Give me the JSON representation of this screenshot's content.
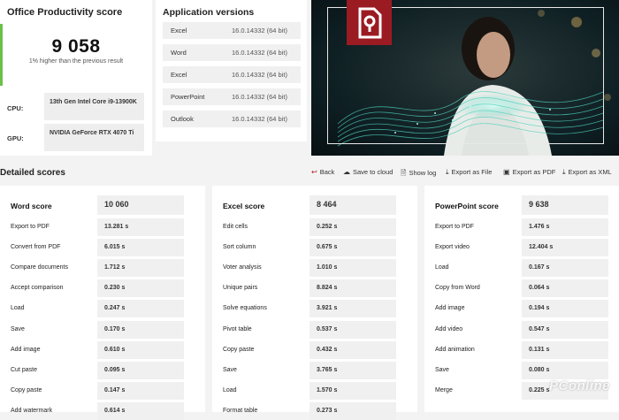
{
  "summary": {
    "title": "Office Productivity score",
    "score": "9 058",
    "comparison": "1% higher than the previous result",
    "cpu_label": "CPU:",
    "cpu_value": "13th Gen Intel Core i9-13900K",
    "gpu_label": "GPU:",
    "gpu_value": "NVIDIA GeForce RTX 4070 Ti",
    "accent_color": "#6cc04a"
  },
  "apps": {
    "title": "Application versions",
    "rows": [
      {
        "name": "Excel",
        "version": "16.0.14332 (64 bit)"
      },
      {
        "name": "Word",
        "version": "16.0.14332 (64 bit)"
      },
      {
        "name": "Excel",
        "version": "16.0.14332 (64 bit)"
      },
      {
        "name": "PowerPoint",
        "version": "16.0.14332 (64 bit)"
      },
      {
        "name": "Outlook",
        "version": "16.0.14332 (64 bit)"
      }
    ]
  },
  "hero": {
    "logo_color": "#9b1b23"
  },
  "detailed": {
    "title": "Detailed scores",
    "toolbar": {
      "back": "Back",
      "save_cloud": "Save to cloud",
      "show_log": "Show log",
      "export_file": "Export as File",
      "export_pdf": "Export as PDF",
      "export_xml": "Export as XML"
    }
  },
  "panels": [
    {
      "title": "Word score",
      "score": "10 060",
      "rows": [
        {
          "label": "Export to PDF",
          "value": "13.281 s"
        },
        {
          "label": "Convert from PDF",
          "value": "6.015 s"
        },
        {
          "label": "Compare documents",
          "value": "1.712 s"
        },
        {
          "label": "Accept comparison",
          "value": "0.230 s"
        },
        {
          "label": "Load",
          "value": "0.247 s"
        },
        {
          "label": "Save",
          "value": "0.170 s"
        },
        {
          "label": "Add image",
          "value": "0.610 s"
        },
        {
          "label": "Cut paste",
          "value": "0.095 s"
        },
        {
          "label": "Copy paste",
          "value": "0.147 s"
        },
        {
          "label": "Add watermark",
          "value": "0.614 s"
        }
      ]
    },
    {
      "title": "Excel score",
      "score": "8 464",
      "rows": [
        {
          "label": "Edit cells",
          "value": "0.252 s"
        },
        {
          "label": "Sort column",
          "value": "0.675 s"
        },
        {
          "label": "Voter analysis",
          "value": "1.010 s"
        },
        {
          "label": "Unique pairs",
          "value": "8.824 s"
        },
        {
          "label": "Solve equations",
          "value": "3.921 s"
        },
        {
          "label": "Pivot table",
          "value": "0.537 s"
        },
        {
          "label": "Copy paste",
          "value": "0.432 s"
        },
        {
          "label": "Save",
          "value": "3.765 s"
        },
        {
          "label": "Load",
          "value": "1.570 s"
        },
        {
          "label": "Format table",
          "value": "0.273 s"
        }
      ]
    },
    {
      "title": "PowerPoint score",
      "score": "9 638",
      "rows": [
        {
          "label": "Export to PDF",
          "value": "1.476 s"
        },
        {
          "label": "Export video",
          "value": "12.404 s"
        },
        {
          "label": "Load",
          "value": "0.167 s"
        },
        {
          "label": "Copy from Word",
          "value": "0.064 s"
        },
        {
          "label": "Add image",
          "value": "0.194 s"
        },
        {
          "label": "Add video",
          "value": "0.547 s"
        },
        {
          "label": "Add animation",
          "value": "0.131 s"
        },
        {
          "label": "Save",
          "value": "0.080 s"
        },
        {
          "label": "Merge",
          "value": "0.225 s"
        }
      ]
    }
  ],
  "watermark": "PConline"
}
